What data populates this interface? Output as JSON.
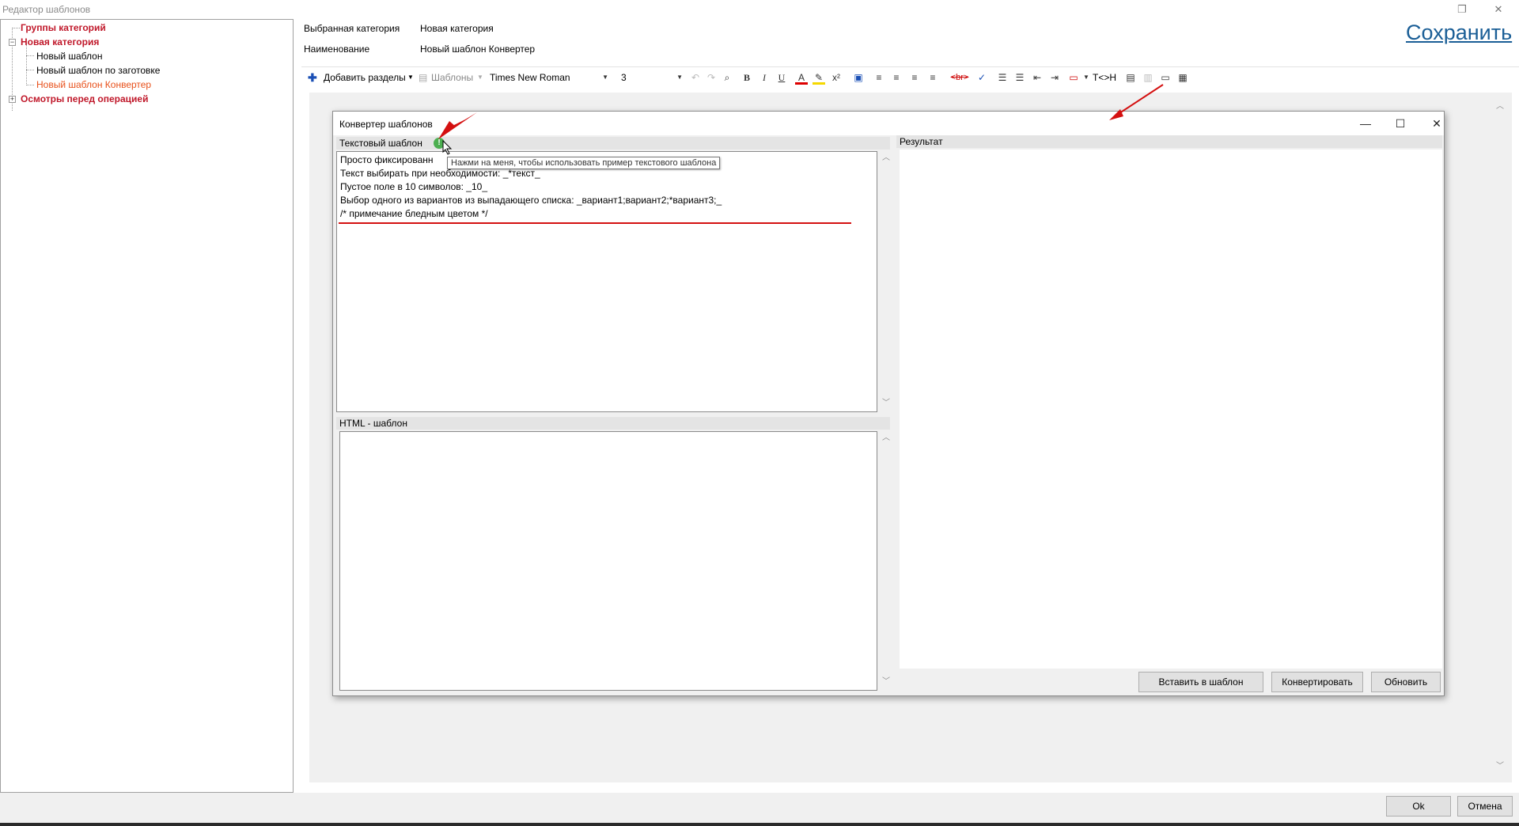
{
  "window": {
    "title": "Редактор шаблонов",
    "restore_glyph": "❐",
    "close_glyph": "✕"
  },
  "tree": {
    "items": [
      {
        "label": "Группы категорий",
        "style": "bold"
      },
      {
        "label": "Новая категория",
        "style": "bold",
        "expander": "−"
      },
      {
        "label": "Новый шаблон",
        "style": "plain"
      },
      {
        "label": "Новый шаблон по заготовке",
        "style": "plain"
      },
      {
        "label": "Новый шаблон Конвертер",
        "style": "selected"
      },
      {
        "label": "Осмотры перед операцией",
        "style": "bold",
        "expander": "+"
      }
    ]
  },
  "header": {
    "category_label": "Выбранная категория",
    "category_value": "Новая категория",
    "name_label": "Наименование",
    "name_value": "Новый шаблон Конвертер",
    "save_label": "Сохранить"
  },
  "toolbar": {
    "add_sections": "Добавить разделы",
    "templates": "Шаблоны",
    "font_name": "Times New Roman",
    "font_size": "3",
    "tc_h": "T<>H"
  },
  "dialog": {
    "title": "Конвертер шаблонов",
    "minimize_glyph": "—",
    "maximize_glyph": "☐",
    "close_glyph": "✕",
    "text_template_label": "Текстовый шаблон",
    "info_glyph": "!",
    "tooltip": "Нажми на меня, чтобы использовать пример текстового шаблона",
    "template_lines": [
      "Просто фиксированн",
      "Текст выбирать при необходимости: _*текст_",
      "Пустое поле в 10 символов: _10_",
      "Выбор одного из вариантов из выпадающего списка:   _вариант1;вариант2;*вариант3;_",
      "/* примечание бледным цветом */"
    ],
    "html_template_label": "HTML - шаблон",
    "result_label": "Результат",
    "buttons": {
      "insert": "Вставить в шаблон",
      "convert": "Конвертировать",
      "refresh": "Обновить"
    }
  },
  "footer": {
    "ok": "Ok",
    "cancel": "Отмена"
  },
  "colors": {
    "tree_bold": "#c0182a",
    "tree_selected": "#e8501a",
    "link": "#1a5e96",
    "annotation": "#d41010"
  }
}
